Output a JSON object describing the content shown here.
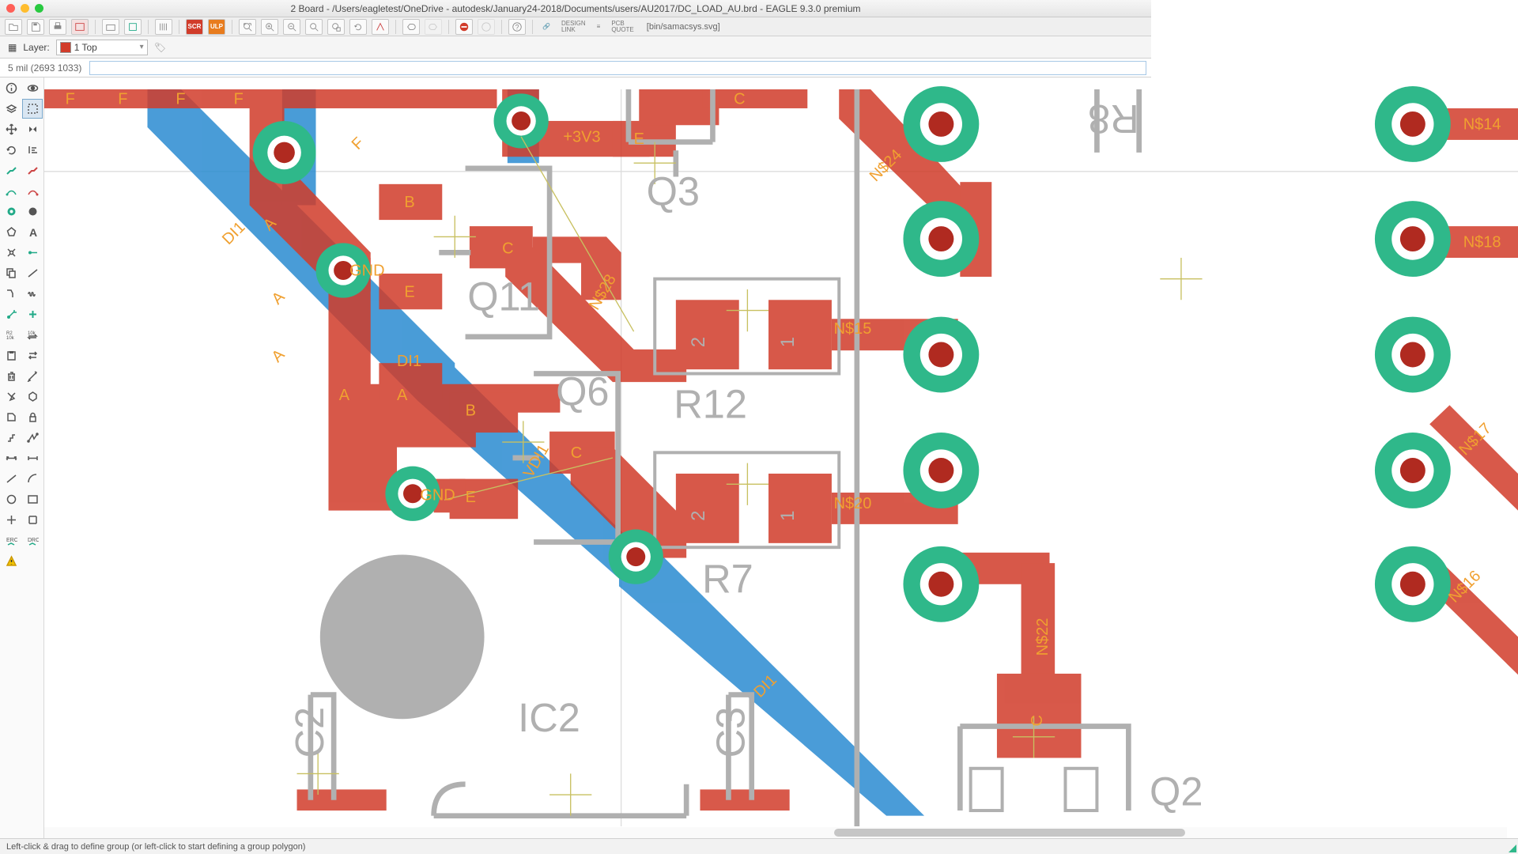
{
  "window": {
    "title": "2 Board - /Users/eagletest/OneDrive - autodesk/January24-2018/Documents/users/AU2017/DC_LOAD_AU.brd - EAGLE 9.3.0 premium"
  },
  "toolbar": {
    "design_top": "DESIGN",
    "design_bot": "LINK",
    "pcb_top": "PCB",
    "pcb_bot": "QUOTE",
    "filepath": "[bin/samacsys.svg]",
    "scr": "SCR",
    "ulp": "ULP"
  },
  "layerbar": {
    "label": "Layer:",
    "selected": "1 Top"
  },
  "cmdbar": {
    "coord": "5 mil (2693 1033)",
    "value": ""
  },
  "status": {
    "text": "Left-click & drag to define group (or left-click to start defining a group polygon)"
  },
  "pcb": {
    "components": {
      "Q3": "Q3",
      "Q11": "Q11",
      "Q6": "Q6",
      "R12": "R12",
      "R7": "R7",
      "IC2": "IC2",
      "R8": "R8",
      "Q2": "Q2",
      "C2": "C2",
      "C3": "C3"
    },
    "nets": {
      "p3v3": "+3V3",
      "gnd": "GND",
      "di1": "DI1",
      "vdi1": "VDI1",
      "n15": "N$15",
      "n20": "N$20",
      "n24": "N$24",
      "n28": "N$28",
      "n22": "N$22",
      "n14": "N$14",
      "n17": "N$17",
      "n16": "N$16",
      "n18": "N$18",
      "A": "A",
      "B": "B",
      "C": "C",
      "E": "E",
      "F": "F",
      "p1": "1",
      "p2": "2"
    }
  }
}
